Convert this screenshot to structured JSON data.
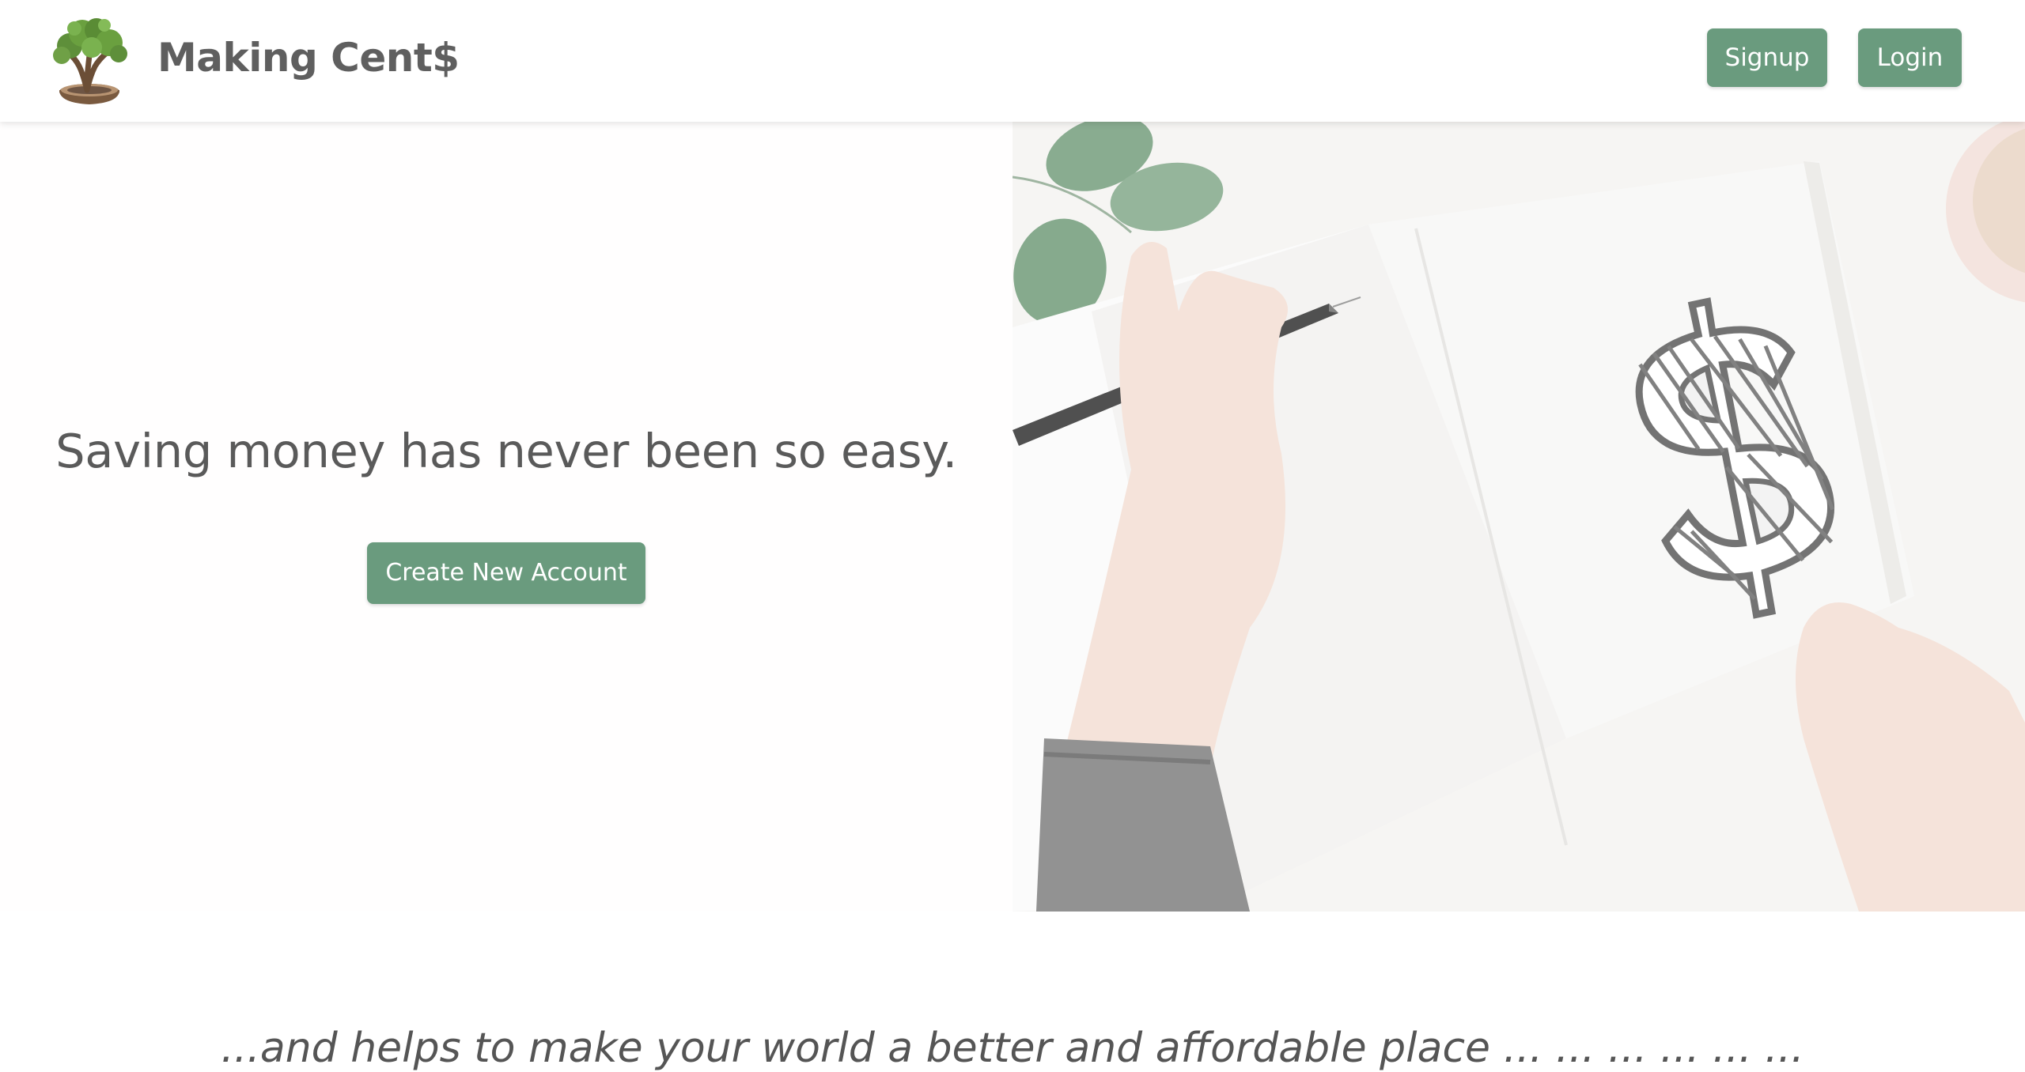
{
  "brand": {
    "name": "Making Cent$",
    "logo_icon": "bonsai-tree-logo"
  },
  "nav": {
    "signup_label": "Signup",
    "login_label": "Login"
  },
  "hero": {
    "tagline": "Saving money has never been so easy.",
    "cta_label": "Create New Account",
    "image": "hand-drawing-dollar-sign-illustration"
  },
  "footer": {
    "text": "...and helps to make your world a better and affordable place ... ... ... ... ... ..."
  },
  "colors": {
    "accent": "#6a9b7e",
    "text": "#5a5a5a",
    "background": "#ffffff"
  }
}
